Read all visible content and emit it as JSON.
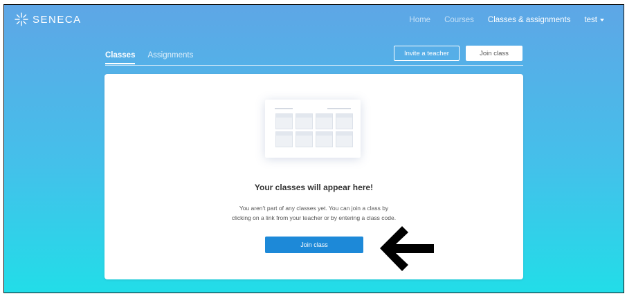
{
  "brand": {
    "name": "SENECA"
  },
  "nav": {
    "items": [
      {
        "label": "Home"
      },
      {
        "label": "Courses"
      },
      {
        "label": "Classes & assignments"
      }
    ],
    "user": "test"
  },
  "tabs": [
    {
      "label": "Classes",
      "active": true
    },
    {
      "label": "Assignments",
      "active": false
    }
  ],
  "actions": {
    "invite_label": "Invite a teacher",
    "join_label": "Join class"
  },
  "empty_state": {
    "heading": "Your classes will appear here!",
    "line1": "You aren't part of any classes yet. You can join a class by",
    "line2": "clicking on a link from your teacher or by entering a class code.",
    "button_label": "Join class"
  },
  "colors": {
    "gradient_top": "#5ea6e6",
    "gradient_bottom": "#22dde8",
    "primary_button": "#1d89d8"
  },
  "annotation": {
    "icon": "left-arrow-icon"
  }
}
